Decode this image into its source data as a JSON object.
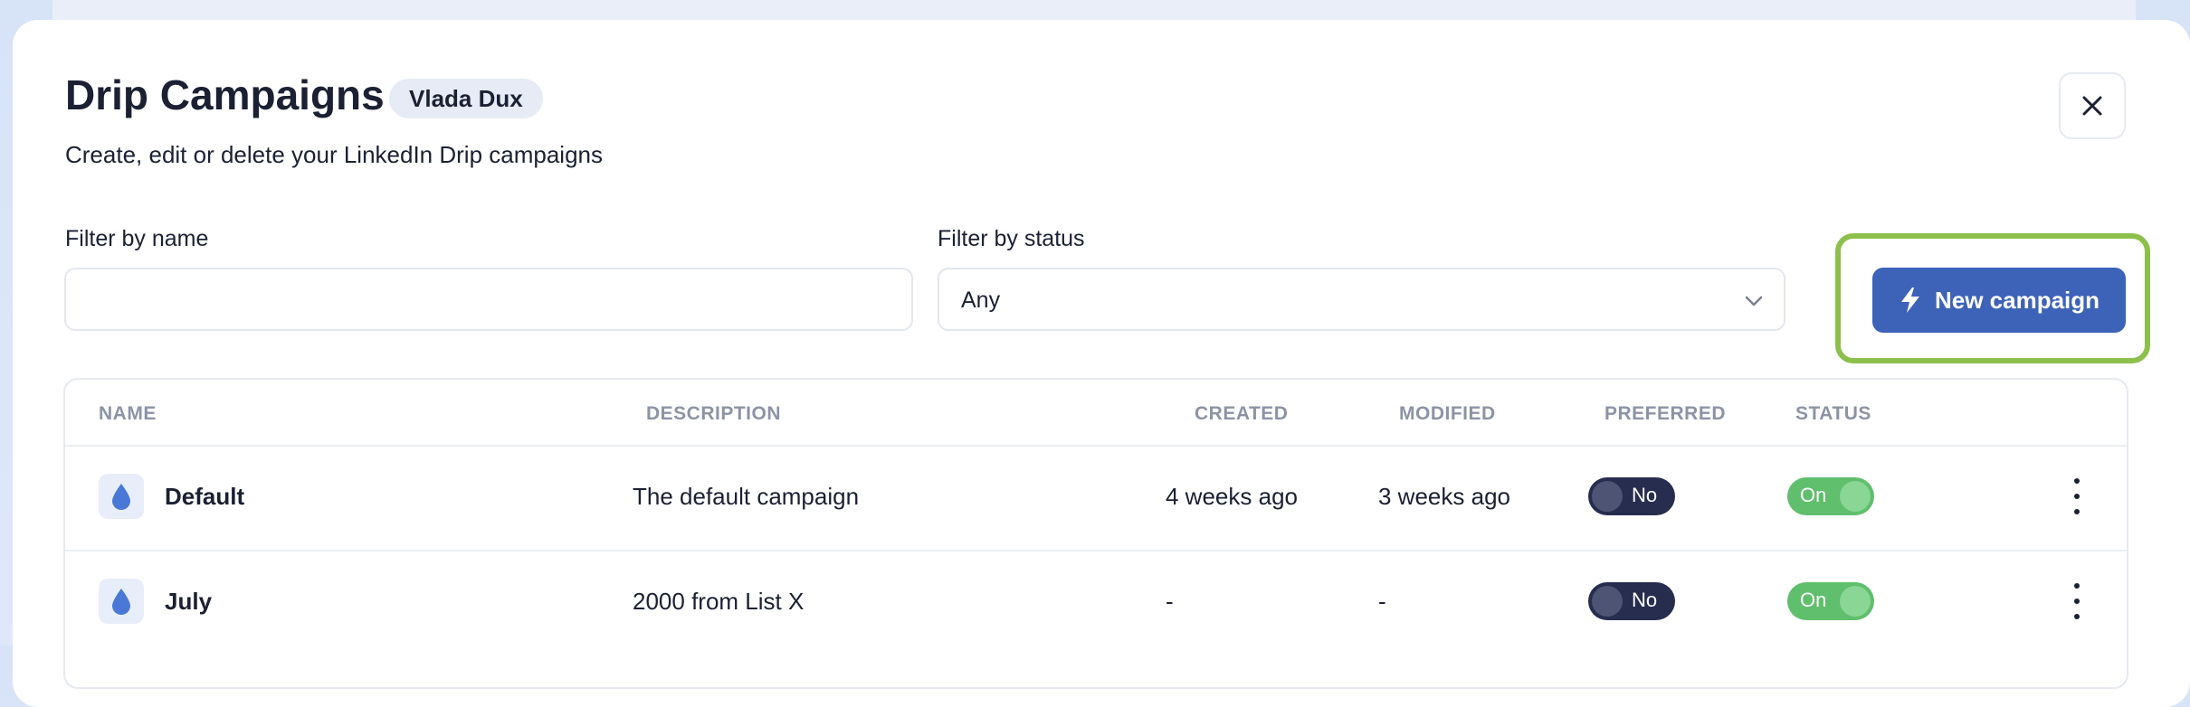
{
  "header": {
    "title": "Drip Campaigns",
    "user_badge": "Vlada Dux",
    "subtitle": "Create, edit or delete your LinkedIn Drip campaigns"
  },
  "filters": {
    "name_label": "Filter by name",
    "name_value": "",
    "status_label": "Filter by status",
    "status_value": "Any"
  },
  "actions": {
    "new_campaign_label": "New campaign"
  },
  "table": {
    "columns": [
      "NAME",
      "DESCRIPTION",
      "CREATED",
      "MODIFIED",
      "PREFERRED",
      "STATUS"
    ],
    "rows": [
      {
        "name": "Default",
        "description": "The default campaign",
        "created": "4 weeks ago",
        "modified": "3 weeks ago",
        "preferred": "No",
        "status": "On"
      },
      {
        "name": "July",
        "description": "2000 from List X",
        "created": "-",
        "modified": "-",
        "preferred": "No",
        "status": "On"
      }
    ]
  },
  "colors": {
    "primary": "#3d63b8",
    "highlight": "#8cc04b",
    "toggle_on": "#5fbf6c",
    "toggle_off": "#262d4f"
  },
  "icons": {
    "close": "close-icon",
    "chevron": "chevron-down-icon",
    "bolt": "lightning-icon",
    "drop": "drop-icon",
    "more": "more-vertical-icon"
  }
}
